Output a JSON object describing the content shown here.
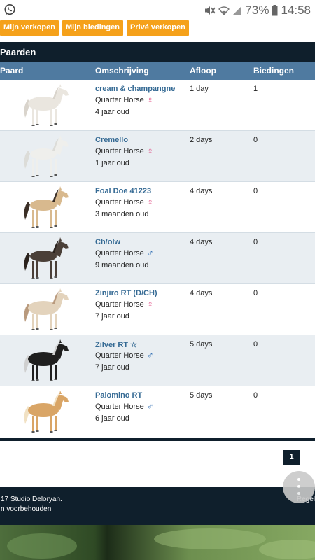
{
  "status": {
    "battery": "73%",
    "time": "14:58"
  },
  "tabs": [
    "Mijn verkopen",
    "Mijn biedingen",
    "Privé verkopen"
  ],
  "section_title": "Paarden",
  "columns": {
    "paard": "Paard",
    "omschrijving": "Omschrijving",
    "afloop": "Afloop",
    "biedingen": "Biedingen"
  },
  "rows": [
    {
      "name": "cream & champangne",
      "breed": "Quarter Horse",
      "gender": "female",
      "gender_symbol": "♀",
      "age": "4 jaar oud",
      "afloop": "1 day",
      "biedingen": "1",
      "coat": "#eae6df",
      "mane": "#d9d4cc",
      "pose": "adult"
    },
    {
      "name": "Cremello",
      "breed": "Quarter Horse",
      "gender": "female",
      "gender_symbol": "♀",
      "age": "1 jaar oud",
      "afloop": "2 days",
      "biedingen": "0",
      "coat": "#efefec",
      "mane": "#dcdcd8",
      "pose": "foal"
    },
    {
      "name": "Foal Doe 41223",
      "breed": "Quarter Horse",
      "gender": "female",
      "gender_symbol": "♀",
      "age": "3 maanden oud",
      "afloop": "4 days",
      "biedingen": "0",
      "coat": "#d8b98e",
      "mane": "#3b2f26",
      "pose": "foal"
    },
    {
      "name": "Ch/olw",
      "breed": "Quarter Horse",
      "gender": "male",
      "gender_symbol": "♂",
      "age": "9 maanden oud",
      "afloop": "4 days",
      "biedingen": "0",
      "coat": "#4a3f38",
      "mane": "#2a221d",
      "pose": "foal"
    },
    {
      "name": "Zinjiro RT (D/CH)",
      "breed": "Quarter Horse",
      "gender": "female",
      "gender_symbol": "♀",
      "age": "7 jaar oud",
      "afloop": "4 days",
      "biedingen": "0",
      "coat": "#e3d3bc",
      "mane": "#b99a7d",
      "pose": "adult"
    },
    {
      "name": "Zilver RT ☆",
      "breed": "Quarter Horse",
      "gender": "male",
      "gender_symbol": "♂",
      "age": "7 jaar oud",
      "afloop": "5 days",
      "biedingen": "0",
      "coat": "#1f1f1f",
      "mane": "#cfcfcf",
      "pose": "adult"
    },
    {
      "name": "Palomino RT",
      "breed": "Quarter Horse",
      "gender": "male",
      "gender_symbol": "♂",
      "age": "6 jaar oud",
      "afloop": "5 days",
      "biedingen": "0",
      "coat": "#d9a566",
      "mane": "#f1e1c3",
      "pose": "adult"
    }
  ],
  "pager": {
    "current": "1"
  },
  "footer": {
    "line1": "17 Studio Deloryan.",
    "line2": "n voorbehouden",
    "rules": "Regel"
  },
  "colors": {
    "tab": "#f5a11a",
    "dark": "#0f1f2c",
    "header": "#4f7aa0",
    "link": "#356a94"
  }
}
